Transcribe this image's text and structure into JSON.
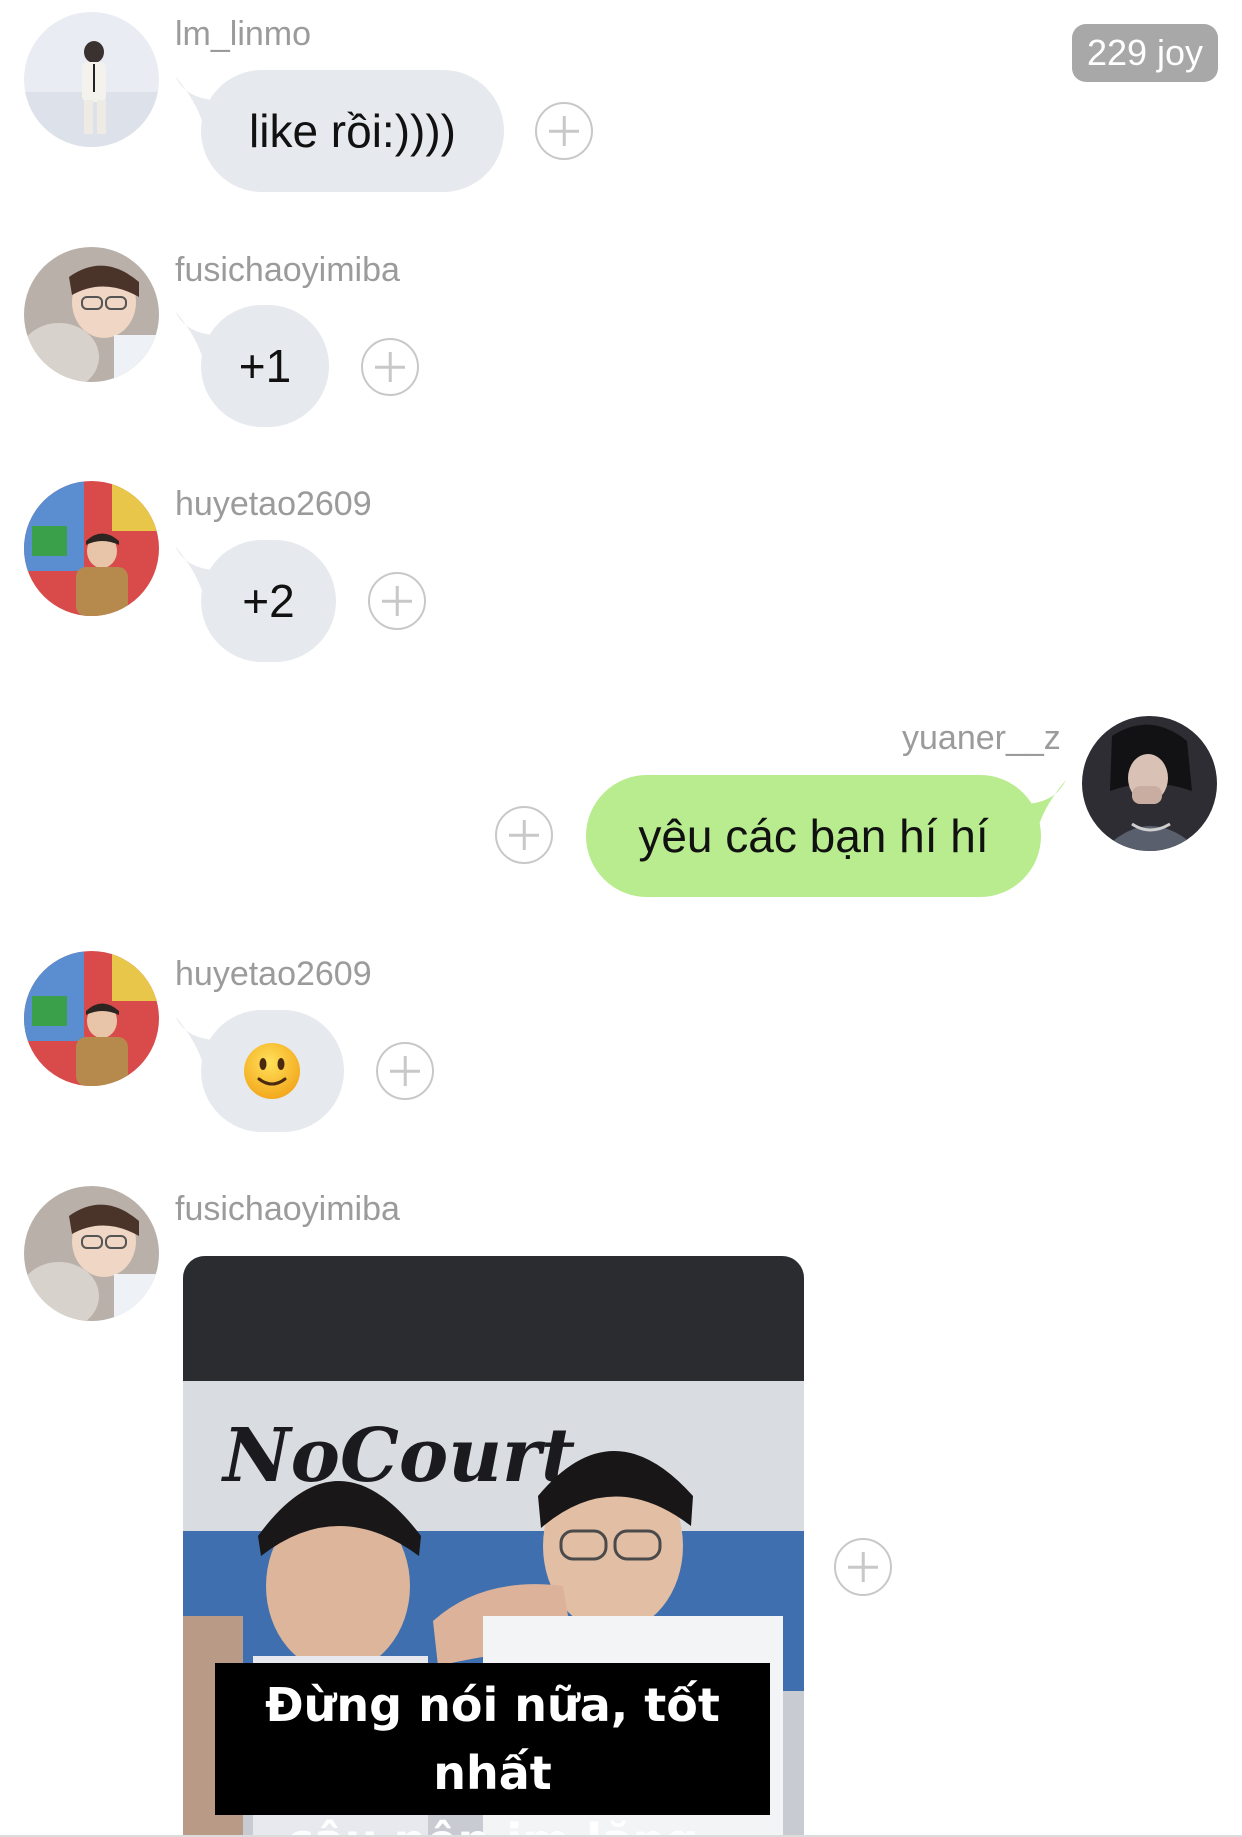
{
  "header": {
    "joy_badge": "229 joy"
  },
  "messages": [
    {
      "username": "lm_linmo",
      "text": "like rồi:))))",
      "avatar": "avatar-lm-linmo"
    },
    {
      "username": "fusichaoyimiba",
      "text": "+1",
      "avatar": "avatar-fusichaoyimiba"
    },
    {
      "username": "huyetao2609",
      "text": "+2",
      "avatar": "avatar-huyetao2609"
    },
    {
      "username": "yuaner__z",
      "text": "yêu các bạn hí hí",
      "avatar": "avatar-yuaner-z"
    },
    {
      "username": "huyetao2609",
      "emoji": "slightly-smiling-face-emoji",
      "avatar": "avatar-huyetao2609"
    },
    {
      "username": "fusichaoyimiba",
      "avatar": "avatar-fusichaoyimiba",
      "image": {
        "caption_line1": "Đừng nói nữa, tốt nhất",
        "caption_line2": "cậu nên im lặng",
        "background_text": "NoCourt"
      }
    }
  ],
  "colors": {
    "incoming_bubble": "#e6e9ed",
    "outgoing_bubble": "#b8ec8f",
    "username": "#9b9b9b",
    "badge": "#a8a8a8"
  },
  "icons": {
    "react": "plus-circle-icon"
  }
}
